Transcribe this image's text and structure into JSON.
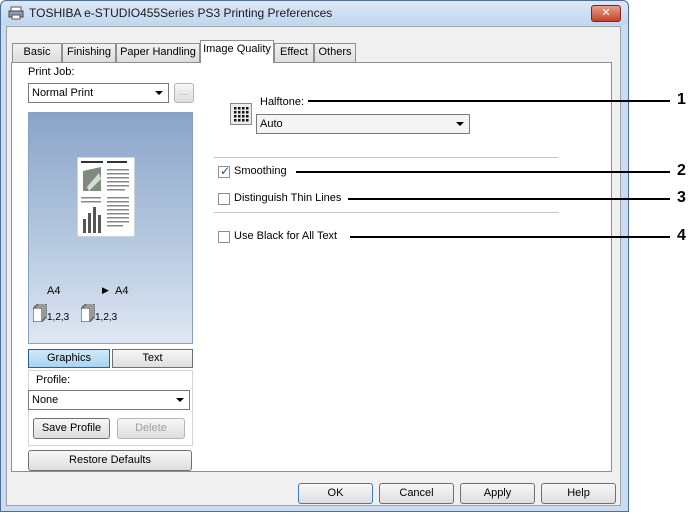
{
  "window": {
    "title": "TOSHIBA e-STUDIO455Series PS3 Printing Preferences",
    "close_label": "✕"
  },
  "tabs": [
    {
      "label": "Basic",
      "active": false
    },
    {
      "label": "Finishing",
      "active": false
    },
    {
      "label": "Paper Handling",
      "active": false
    },
    {
      "label": "Image Quality",
      "active": true
    },
    {
      "label": "Effect",
      "active": false
    },
    {
      "label": "Others",
      "active": false
    }
  ],
  "left": {
    "print_job_label": "Print Job:",
    "print_job_value": "Normal Print",
    "more_button": "...",
    "preview": {
      "orig_size": "A4",
      "out_size": "A4",
      "orig_pages": "1,2,3",
      "out_pages": "1,2,3"
    },
    "graphics_label": "Graphics",
    "text_label": "Text",
    "profile_label": "Profile:",
    "profile_value": "None",
    "save_profile_label": "Save Profile",
    "delete_label": "Delete",
    "restore_defaults_label": "Restore Defaults"
  },
  "main": {
    "halftone_label": "Halftone:",
    "halftone_value": "Auto",
    "smoothing_label": "Smoothing",
    "smoothing_checked": true,
    "thin_lines_label": "Distinguish Thin Lines",
    "thin_lines_checked": false,
    "black_text_label": "Use Black for All Text",
    "black_text_checked": false
  },
  "footer": {
    "ok_label": "OK",
    "cancel_label": "Cancel",
    "apply_label": "Apply",
    "help_label": "Help"
  },
  "callouts": [
    "1",
    "2",
    "3",
    "4"
  ]
}
